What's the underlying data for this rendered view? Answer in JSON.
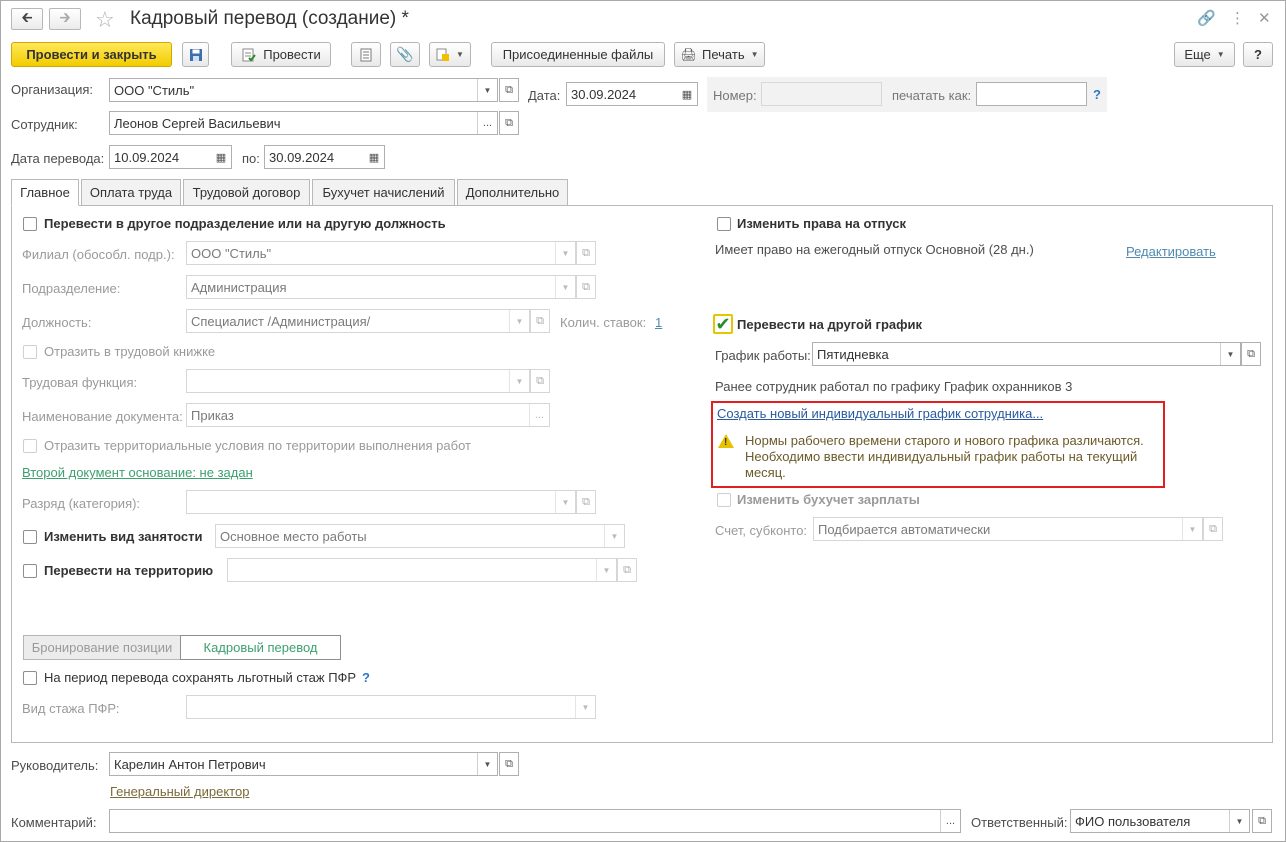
{
  "window": {
    "title": "Кадровый перевод (создание) *"
  },
  "toolbar": {
    "post_close": "Провести и закрыть",
    "post": "Провести",
    "attached_files": "Присоединенные файлы",
    "print": "Печать",
    "more": "Еще",
    "help": "?"
  },
  "header": {
    "org_label": "Организация:",
    "org_value": "ООО \"Стиль\"",
    "date_label": "Дата:",
    "date_value": "30.09.2024",
    "number_label": "Номер:",
    "number_value": "",
    "print_as_label": "печатать как:",
    "print_as_value": "",
    "help": "?",
    "employee_label": "Сотрудник:",
    "employee_value": "Леонов Сергей Васильевич",
    "transfer_date_label": "Дата перевода:",
    "transfer_date_value": "10.09.2024",
    "to_label": "по:",
    "to_value": "30.09.2024"
  },
  "tabs": [
    {
      "label": "Главное"
    },
    {
      "label": "Оплата труда"
    },
    {
      "label": "Трудовой договор"
    },
    {
      "label": "Бухучет начислений"
    },
    {
      "label": "Дополнительно"
    }
  ],
  "main": {
    "transfer_dept_label": "Перевести в другое подразделение или на другую должность",
    "branch_label": "Филиал (обособл. подр.):",
    "branch_value": "ООО \"Стиль\"",
    "dept_label": "Подразделение:",
    "dept_value": "Администрация",
    "position_label": "Должность:",
    "position_value": "Специалист /Администрация/",
    "rates_label": "Колич. ставок:",
    "rates_value": "1",
    "labor_book_label": "Отразить в трудовой книжке",
    "labor_function_label": "Трудовая функция:",
    "labor_function_value": "",
    "doc_name_label": "Наименование документа:",
    "doc_name_value": "Приказ",
    "territorial_label": "Отразить территориальные условия по территории выполнения работ",
    "second_doc_link": "Второй документ основание: не задан",
    "grade_label": "Разряд (категория):",
    "grade_value": "",
    "employment_type_label": "Изменить вид занятости",
    "employment_type_value": "Основное место работы",
    "territory_label": "Перевести на территорию",
    "territory_value": "",
    "seg_booking": "Бронирование позиции",
    "seg_transfer": "Кадровый перевод",
    "pfr_keep_label": "На период перевода сохранять льготный стаж ПФР",
    "pfr_help": "?",
    "pfr_kind_label": "Вид стажа ПФР:",
    "pfr_kind_value": "",
    "vacation_label": "Изменить права на отпуск",
    "vacation_info": "Имеет право на ежегодный отпуск Основной (28 дн.)",
    "vacation_edit": "Редактировать",
    "schedule_label": "Перевести на другой график",
    "schedule_checked": true,
    "work_schedule_label": "График работы:",
    "work_schedule_value": "Пятидневка",
    "previous_schedule": "Ранее сотрудник работал по графику График охранников 3",
    "create_schedule_link": "Создать новый индивидуальный график сотрудника...",
    "warning_line1": "Нормы рабочего времени старого и нового графика различаются.",
    "warning_line2": "Необходимо ввести индивидуальный график работы на текущий",
    "warning_line3": "месяц.",
    "salary_accounting_label": "Изменить бухучет зарплаты",
    "account_label": "Счет, субконто:",
    "account_placeholder": "Подбирается автоматически"
  },
  "footer": {
    "manager_label": "Руководитель:",
    "manager_value": "Карелин Антон Петрович",
    "manager_position": "Генеральный директор",
    "comment_label": "Комментарий:",
    "comment_value": "",
    "responsible_label": "Ответственный:",
    "responsible_value": "ФИО пользователя"
  },
  "colors": {
    "primary_button": "#f5d218",
    "link": "#4f8ab0",
    "warning_border": "#e02020",
    "check": "#2c8a2c"
  }
}
